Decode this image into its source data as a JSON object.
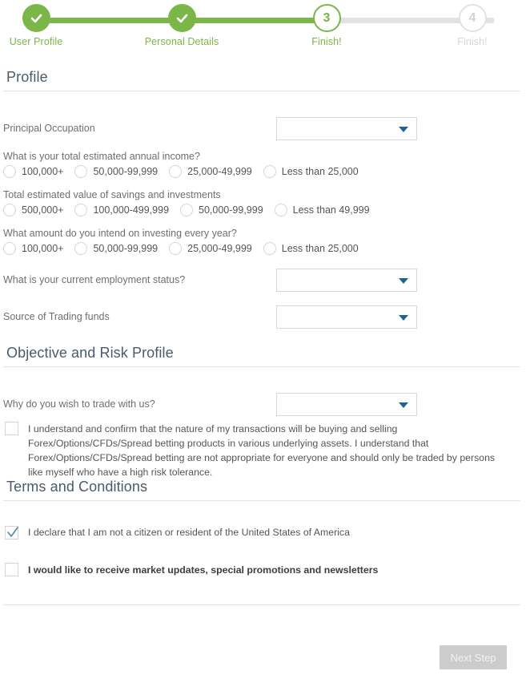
{
  "stepper": {
    "fill_color": "#7ab648",
    "track_color": "#e2e2e2",
    "steps": [
      {
        "number": "1",
        "label": "User Profile",
        "state": "done",
        "icon": "check-icon"
      },
      {
        "number": "2",
        "label": "Personal Details",
        "state": "done",
        "icon": "check-icon"
      },
      {
        "number": "3",
        "label": "Finish!",
        "state": "current",
        "icon": ""
      },
      {
        "number": "4",
        "label": "Finish!",
        "state": "todo",
        "icon": ""
      }
    ]
  },
  "sections": {
    "profile": {
      "title": "Profile"
    },
    "objective": {
      "title": "Objective and Risk Profile"
    },
    "terms": {
      "title": "Terms and Conditions"
    }
  },
  "profile": {
    "occupation": {
      "label": "Principal Occupation",
      "value": "",
      "caret": "chevron-down-icon"
    },
    "income": {
      "question": "What is your total estimated annual income?",
      "options": [
        "100,000+",
        "50,000-99,999",
        "25,000-49,999",
        "Less than 25,000"
      ],
      "selected": ""
    },
    "savings": {
      "question": "Total estimated value of savings and investments",
      "options": [
        "500,000+",
        "100,000-499,999",
        "50,000-99,999",
        "Less than 49,999"
      ],
      "selected": ""
    },
    "investing": {
      "question": "What amount do you intend on investing every year?",
      "options": [
        "100,000+",
        "50,000-99,999",
        "25,000-49,999",
        "Less than 25,000"
      ],
      "selected": ""
    },
    "employment": {
      "label": "What is your current employment status?",
      "value": ""
    },
    "funds": {
      "label": "Source of Trading funds",
      "value": ""
    }
  },
  "objective": {
    "trade_reason": {
      "label": "Why do you wish to trade with us?",
      "value": ""
    },
    "risk_ack": {
      "checked": false,
      "text": "I understand and confirm that the nature of my transactions will be buying and selling Forex/Options/CFDs/Spread betting products in various underlying assets. I understand that Forex/Options/CFDs/Spread betting are not appropriate for everyone and should only be traded by persons like myself who have a high risk tolerance."
    }
  },
  "terms": {
    "us_citizen": {
      "checked": true,
      "text": "I declare that I am not a citizen or resident of the United States of America"
    },
    "newsletter": {
      "checked": false,
      "text": "I would like to receive market updates, special promotions and newsletters"
    }
  },
  "footer": {
    "next_label": "Next Step",
    "next_disabled": true
  }
}
